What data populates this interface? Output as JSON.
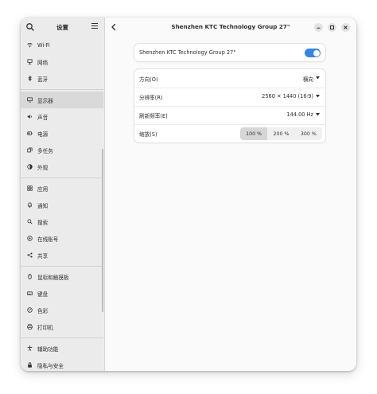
{
  "sidebar": {
    "title": "设置",
    "items": [
      {
        "label": "Wi-Fi",
        "icon": "wifi-icon"
      },
      {
        "label": "网络",
        "icon": "network-icon"
      },
      {
        "label": "蓝牙",
        "icon": "bluetooth-icon"
      },
      {
        "label": "显示器",
        "icon": "display-icon"
      },
      {
        "label": "声音",
        "icon": "sound-icon"
      },
      {
        "label": "电源",
        "icon": "power-icon"
      },
      {
        "label": "多任务",
        "icon": "multitasking-icon"
      },
      {
        "label": "外观",
        "icon": "appearance-icon"
      },
      {
        "label": "应用",
        "icon": "apps-icon"
      },
      {
        "label": "通知",
        "icon": "notifications-icon"
      },
      {
        "label": "搜索",
        "icon": "search-icon"
      },
      {
        "label": "在线账号",
        "icon": "online-accounts-icon"
      },
      {
        "label": "共享",
        "icon": "sharing-icon"
      },
      {
        "label": "鼠标和触摸板",
        "icon": "mouse-icon"
      },
      {
        "label": "键盘",
        "icon": "keyboard-icon"
      },
      {
        "label": "色彩",
        "icon": "color-icon"
      },
      {
        "label": "打印机",
        "icon": "printer-icon"
      },
      {
        "label": "辅助功能",
        "icon": "accessibility-icon"
      },
      {
        "label": "隐私与安全",
        "icon": "privacy-icon"
      }
    ],
    "selected": "显示器"
  },
  "header": {
    "title": "Shenzhen KTC Technology Group 27\""
  },
  "monitor_card": {
    "label": "Shenzhen KTC Technology Group 27\"",
    "enabled": true
  },
  "settings": {
    "orientation": {
      "label": "方向(O)",
      "value": "横向"
    },
    "resolution": {
      "label": "分辨率(R)",
      "value": "2560 ✕ 1440 (16∶9)"
    },
    "refresh_rate": {
      "label": "刷新频率(E)",
      "value": "144.00 Hz"
    },
    "scale": {
      "label": "缩放(S)",
      "options": [
        "100 %",
        "200 %",
        "300 %"
      ],
      "selected": "100 %"
    }
  },
  "colors": {
    "accent": "#3584e4"
  }
}
